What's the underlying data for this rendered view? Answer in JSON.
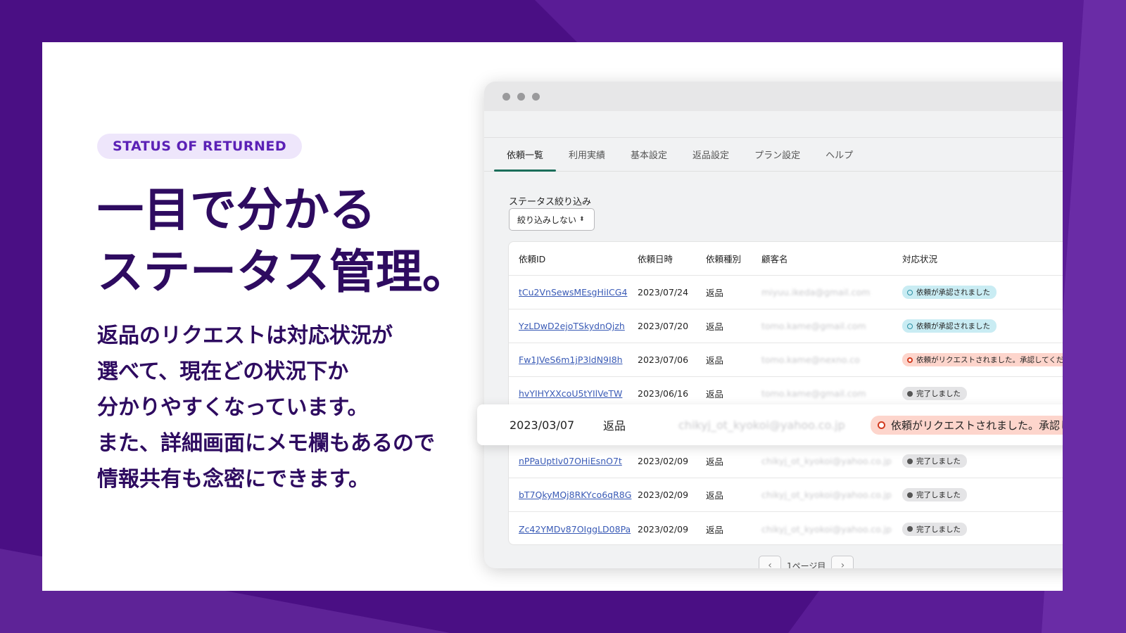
{
  "hero": {
    "tag": "STATUS OF RETURNED",
    "headline_line1": "一目で分かる",
    "headline_line2": "ステータス管理。",
    "body_lines": [
      "返品のリクエストは対応状況が",
      "選べて、現在どの状況下か",
      "分かりやすくなっています。",
      "また、詳細画面にメモ欄もあるので",
      "情報共有も念密にできます。"
    ]
  },
  "app": {
    "tabs": [
      "依頼一覧",
      "利用実績",
      "基本設定",
      "返品設定",
      "プラン設定",
      "ヘルプ"
    ],
    "active_tab": 0,
    "filter": {
      "label": "ステータス絞り込み",
      "value": "絞り込みしない"
    },
    "table": {
      "headers": [
        "依頼ID",
        "依頼日時",
        "依頼種別",
        "顧客名",
        "対応状況"
      ],
      "rows": [
        {
          "id": "tCu2VnSewsMEsgHiICG4",
          "date": "2023/07/24",
          "type": "返品",
          "customer": "miyuu.ikeda@gmail.com",
          "status": "依頼が承認されました",
          "status_kind": "info"
        },
        {
          "id": "YzLDwD2ejoTSkydnQjzh",
          "date": "2023/07/20",
          "type": "返品",
          "customer": "tomo.kame@gmail.com",
          "status": "依頼が承認されました",
          "status_kind": "info"
        },
        {
          "id": "Fw1JVeS6m1jP3ldN9I8h",
          "date": "2023/07/06",
          "type": "返品",
          "customer": "tomo.kame@nexno.co",
          "status": "依頼がリクエストされました。承認してください",
          "status_kind": "warn"
        },
        {
          "id": "hvYIHYXXcoU5tYIlVeTW",
          "date": "2023/06/16",
          "type": "返品",
          "customer": "tomo.kame@gmail.com",
          "status": "完了しました",
          "status_kind": "neutral"
        },
        {
          "id": "",
          "date": "",
          "type": "",
          "customer": "",
          "status": "",
          "status_kind": "hidden"
        },
        {
          "id": "nPPaUptIv07OHiEsnO7t",
          "date": "2023/02/09",
          "type": "返品",
          "customer": "chikyj_ot_kyokoi@yahoo.co.jp",
          "status": "完了しました",
          "status_kind": "neutral"
        },
        {
          "id": "bT7QkyMQj8RKYco6qR8G",
          "date": "2023/02/09",
          "type": "返品",
          "customer": "chikyj_ot_kyokoi@yahoo.co.jp",
          "status": "完了しました",
          "status_kind": "neutral"
        },
        {
          "id": "Zc42YMDv87OIggLD08Pa",
          "date": "2023/02/09",
          "type": "返品",
          "customer": "chikyj_ot_kyokoi@yahoo.co.jp",
          "status": "完了しました",
          "status_kind": "neutral"
        }
      ]
    },
    "highlight_row": {
      "date": "2023/03/07",
      "type": "返品",
      "customer": "chikyj_ot_kyokoi@yahoo.co.jp",
      "status": "依頼がリクエストされました。承認してください"
    },
    "pager": {
      "label": "1ページ目",
      "prev_icon": "chevron-left-icon",
      "next_icon": "chevron-right-icon"
    }
  },
  "colors": {
    "brand_purple": "#4a0f84",
    "headline": "#2e0b60",
    "tab_accent": "#1b6e5a",
    "link": "#3a5bb6"
  }
}
